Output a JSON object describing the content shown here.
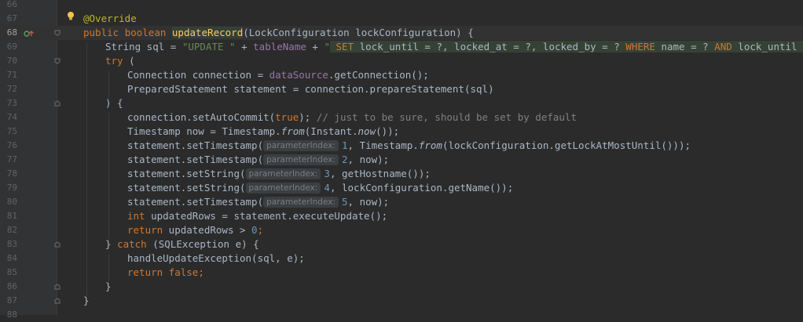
{
  "editor": {
    "lines": [
      {
        "num": "66"
      },
      {
        "num": "67"
      },
      {
        "num": "68"
      },
      {
        "num": "69"
      },
      {
        "num": "70"
      },
      {
        "num": "71"
      },
      {
        "num": "72"
      },
      {
        "num": "73"
      },
      {
        "num": "74"
      },
      {
        "num": "75"
      },
      {
        "num": "76"
      },
      {
        "num": "77"
      },
      {
        "num": "78"
      },
      {
        "num": "79"
      },
      {
        "num": "80"
      },
      {
        "num": "81"
      },
      {
        "num": "82"
      },
      {
        "num": "83"
      },
      {
        "num": "84"
      },
      {
        "num": "85"
      },
      {
        "num": "86"
      },
      {
        "num": "87"
      },
      {
        "num": "88"
      }
    ],
    "tokens": {
      "override": "@Override",
      "public": "public",
      "boolean": "boolean",
      "method_name": "updateRecord",
      "sig_rest": "(LockConfiguration lockConfiguration) {",
      "string_sql": "String sql = ",
      "str_update": "\"UPDATE \"",
      "plus_table": " + ",
      "table_name": "tableName",
      "plus2": " + ",
      "sql_quote_open": "\"",
      "sql_body_1": " ",
      "sql_set": "SET",
      "sql_body_2": " lock_until = ?, locked_at = ?, locked_by = ? ",
      "sql_where": "WHERE",
      "sql_body_3": " name = ? ",
      "sql_and": "AND",
      "sql_body_4": " lock_until <= ?",
      "sql_quote_close": "\"",
      "semi": ";",
      "try": "try",
      "try_paren": " (",
      "conn_decl": "Connection connection = ",
      "datasource": "dataSource",
      "get_conn": ".getConnection();",
      "prep_decl": "PreparedStatement statement = connection.prepareStatement(sql)",
      "close_paren_brace": ") {",
      "set_auto_commit": "connection.setAutoCommit(",
      "true": "true",
      "after_true": "); ",
      "comment": "// just to be sure, should be set by default",
      "ts_decl": "Timestamp now = Timestamp.",
      "from": "from",
      "instant_open": "(Instant.",
      "now_method": "now",
      "instant_close": "());",
      "stmt_set_ts": "statement.setTimestamp(",
      "stmt_set_str": "statement.setString(",
      "param_hint": "parameterIndex:",
      "n1": "1",
      "n2": "2",
      "n3": "3",
      "n4": "4",
      "n5": "5",
      "n0": "0",
      "l77_rest_a": ", Timestamp.",
      "l77_rest_b": "(lockConfiguration.getLockAtMostUntil()));",
      "l78_rest": ", now);",
      "l79_rest": ", getHostname());",
      "l80_rest": ", lockConfiguration.getName());",
      "l81_rest": ", now);",
      "int": "int",
      "l82_rest": " updatedRows = statement.executeUpdate();",
      "return": "return",
      "l83_rest": " updatedRows > ",
      "close_brace": "}",
      "catch": "catch",
      "catch_rest": " (SQLException e) {",
      "handle": "handleUpdateException(sql, e);",
      "false": "false",
      "brace_close": "}"
    }
  }
}
